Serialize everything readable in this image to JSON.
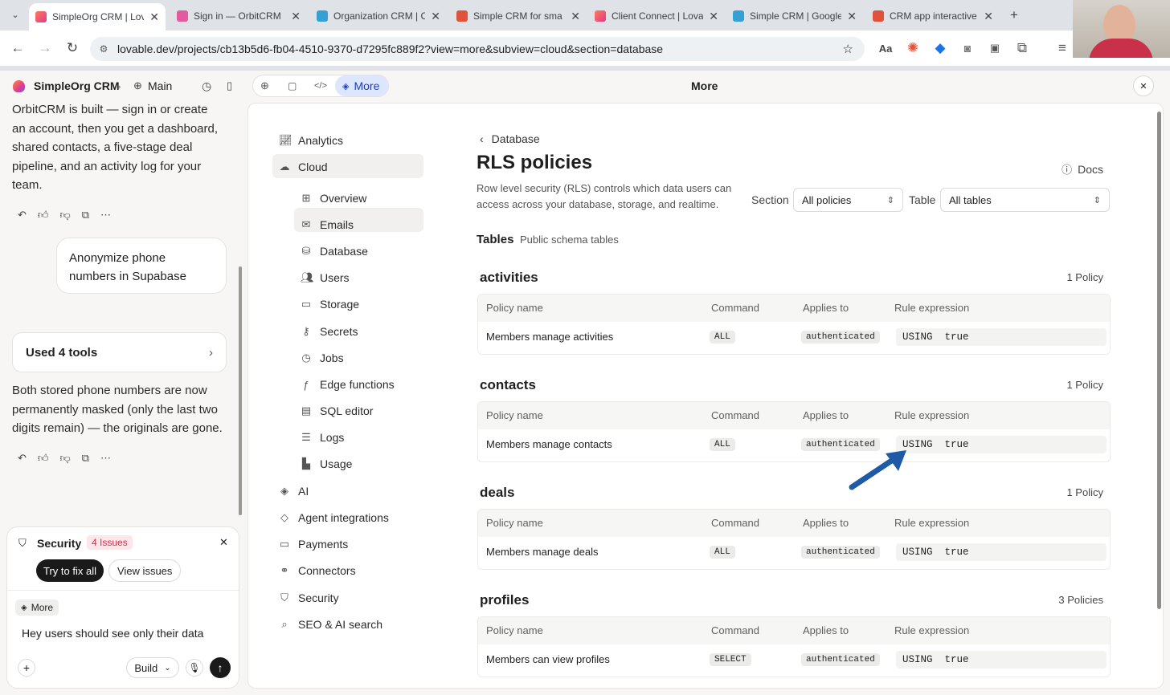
{
  "browser": {
    "tabs": [
      {
        "title": "SimpleOrg CRM | Lov",
        "color": "#e8555b"
      },
      {
        "title": "Sign in — OrbitCRM",
        "color": "#e35aa0"
      },
      {
        "title": "Organization CRM | C",
        "color": "#34a0d3"
      },
      {
        "title": "Simple CRM for sma",
        "color": "#e0533a"
      },
      {
        "title": "Client Connect | Lova",
        "color": "#e8555b"
      },
      {
        "title": "Simple CRM | Google",
        "color": "#34a0d3"
      },
      {
        "title": "CRM app interactive",
        "color": "#e0533a"
      }
    ],
    "url": "lovable.dev/projects/cb13b5d6-fb04-4510-9370-d7295fc889f2?view=more&subview=cloud&section=database"
  },
  "topbar": {
    "project": "SimpleOrg CRM",
    "branch": "Main",
    "more_tab": "More",
    "panel_title": "More"
  },
  "chat": {
    "msg1": "OrbitCRM is built — sign in or create an account, then you get a dashboard, shared contacts, a five-stage deal pipeline, and an activity log for your team.",
    "user_msg": "Anonymize phone numbers in Supabase",
    "tools": "Used 4 tools",
    "msg2": "Both stored phone numbers are now permanently masked (only the last two digits remain) — the originals are gone.",
    "security_label": "Security",
    "issues": "4 Issues",
    "fix_all": "Try to fix all",
    "view_issues": "View issues",
    "more_chip": "More",
    "input": "Hey users should see only their data",
    "build": "Build"
  },
  "nav": {
    "analytics": "Analytics",
    "cloud": "Cloud",
    "sub": [
      "Overview",
      "Emails",
      "Database",
      "Users",
      "Storage",
      "Secrets",
      "Jobs",
      "Edge functions",
      "SQL editor",
      "Logs",
      "Usage"
    ],
    "after": [
      "AI",
      "Agent integrations",
      "Payments",
      "Connectors",
      "Security",
      "SEO & AI search"
    ]
  },
  "content": {
    "breadcrumb": "Database",
    "title": "RLS policies",
    "docs": "Docs",
    "description": "Row level security (RLS) controls which data users can access across your database, storage, and realtime.",
    "section_label": "Section",
    "section_value": "All policies",
    "table_label": "Table",
    "table_value": "All tables",
    "tables_heading": "Tables",
    "tables_sub": "Public schema tables",
    "columns": [
      "Policy name",
      "Command",
      "Applies to",
      "Rule expression"
    ],
    "sections": [
      {
        "name": "activities",
        "count": "1 Policy",
        "policy": "Members manage activities",
        "command": "ALL",
        "applies": "authenticated",
        "rule": "USING  true"
      },
      {
        "name": "contacts",
        "count": "1 Policy",
        "policy": "Members manage contacts",
        "command": "ALL",
        "applies": "authenticated",
        "rule": "USING  true"
      },
      {
        "name": "deals",
        "count": "1 Policy",
        "policy": "Members manage deals",
        "command": "ALL",
        "applies": "authenticated",
        "rule": "USING  true"
      },
      {
        "name": "profiles",
        "count": "3 Policies",
        "policy": "Members can view profiles",
        "command": "SELECT",
        "applies": "authenticated",
        "rule": "USING  true"
      }
    ]
  },
  "colors": {
    "accent": "#dde6ff",
    "badge_red": "#c8354a",
    "arrow": "#1f5aa6"
  }
}
